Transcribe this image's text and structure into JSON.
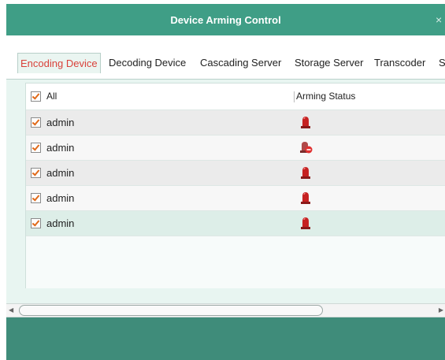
{
  "dialog": {
    "title": "Device Arming Control",
    "close_glyph": "×"
  },
  "tabs": [
    {
      "label": "Encoding Device",
      "active": true
    },
    {
      "label": "Decoding Device",
      "active": false
    },
    {
      "label": "Cascading Server",
      "active": false
    },
    {
      "label": "Storage Server",
      "active": false
    },
    {
      "label": "Transcoder",
      "active": false
    },
    {
      "label": "S",
      "active": false
    }
  ],
  "table": {
    "header": {
      "select_all_label": "All",
      "status_label": "Arming Status",
      "select_all_checked": true
    },
    "rows": [
      {
        "name": "admin",
        "checked": true,
        "status_icon": "alarm-armed-icon"
      },
      {
        "name": "admin",
        "checked": true,
        "status_icon": "alarm-disarmed-icon"
      },
      {
        "name": "admin",
        "checked": true,
        "status_icon": "alarm-armed-icon"
      },
      {
        "name": "admin",
        "checked": true,
        "status_icon": "alarm-armed-icon"
      },
      {
        "name": "admin",
        "checked": true,
        "status_icon": "alarm-armed-icon"
      }
    ]
  },
  "colors": {
    "title_bar": "#3f9e86",
    "active_tab_text": "#d9413a",
    "footer": "#3f8c7a",
    "alarm_red": "#c62222"
  }
}
